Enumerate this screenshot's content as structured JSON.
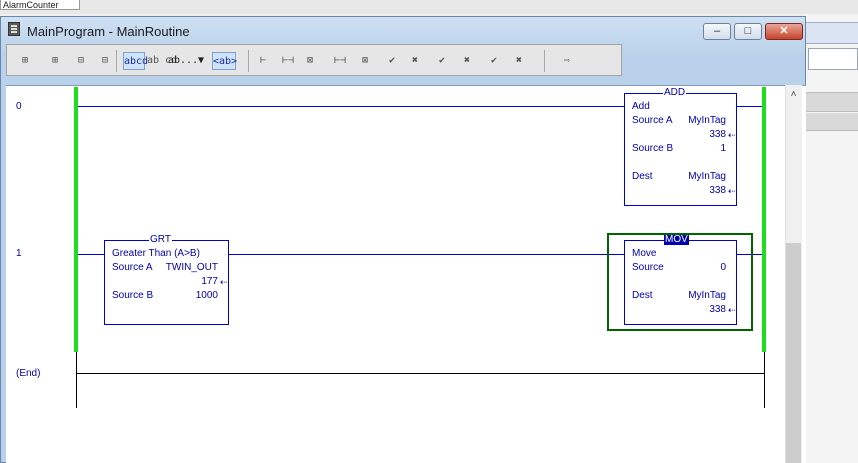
{
  "desktop": {
    "top_tab_label": "AlarmCounter"
  },
  "window": {
    "title": "MainProgram - MainRoutine",
    "minimize_label": "–",
    "maximize_label": "□",
    "close_label": "✕"
  },
  "toolbar": {
    "buttons": [
      "⊞",
      "⊞",
      "⊟",
      "⊟",
      "abcd",
      "ab cd",
      "ab...",
      "▼",
      "<ab>",
      "⊢",
      "⊢⊣",
      "⊠",
      "⊢⊣",
      "⊠",
      "✔",
      "✖",
      "✔",
      "✖",
      "✔",
      "✖",
      "⇨"
    ]
  },
  "ladder": {
    "end_label": "(End)",
    "rungs": [
      {
        "number": "0",
        "add": {
          "block_title": "ADD",
          "name": "Add",
          "source_a_label": "Source A",
          "source_a_tag": "MyInTag",
          "source_a_value": "338",
          "source_b_label": "Source B",
          "source_b_value": "1",
          "dest_label": "Dest",
          "dest_tag": "MyInTag",
          "dest_value": "338"
        }
      },
      {
        "number": "1",
        "grt": {
          "block_title": "GRT",
          "name": "Greater Than (A>B)",
          "source_a_label": "Source A",
          "source_a_tag": "TWIN_OUT",
          "source_a_value": "177",
          "source_b_label": "Source B",
          "source_b_value": "1000"
        },
        "mov": {
          "block_title": "MOV",
          "name": "Move",
          "source_label": "Source",
          "source_value": "0",
          "dest_label": "Dest",
          "dest_tag": "MyInTag",
          "dest_value": "338"
        }
      }
    ]
  }
}
